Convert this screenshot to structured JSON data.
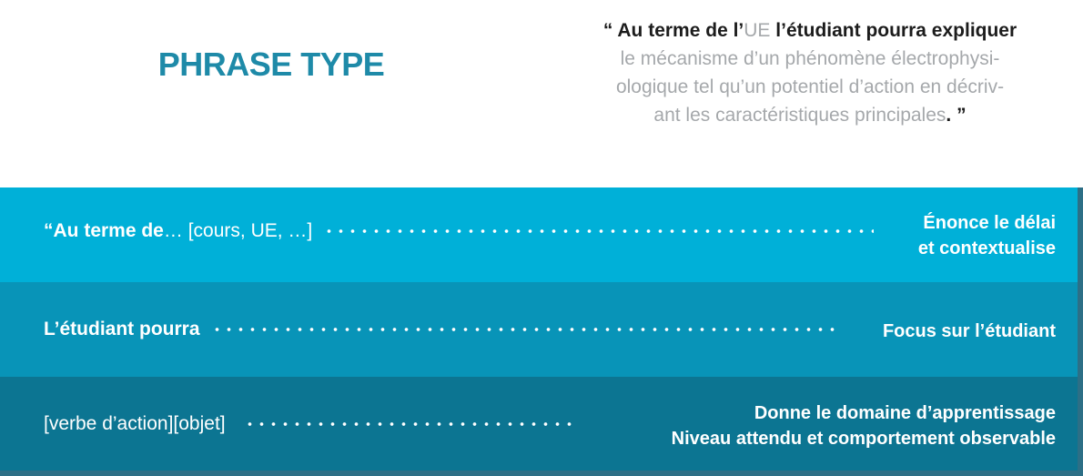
{
  "header": {
    "title": "PHRASE TYPE",
    "quote": {
      "line1_open": "“ Au terme de l’",
      "line1_ue": "UE",
      "line1_rest": " l’étudiant pourra expliquer",
      "line2": "le mécanisme d’un phénomène électrophysi-",
      "line3": "ologique tel qu’un potentiel d’action en décriv-",
      "line4": "ant les caractéristiques principales",
      "line4_end": ". ”"
    }
  },
  "rows": [
    {
      "left_bold": "“Au terme de",
      "left_rest": " … [cours, UE, …]",
      "right": [
        "Énonce le délai",
        "et contextualise"
      ]
    },
    {
      "left_bold": "L’étudiant pourra",
      "left_rest": "",
      "right": [
        "Focus sur l’étudiant"
      ]
    },
    {
      "left_bold": "",
      "left_rest": "[verbe d’action][objet]",
      "right": [
        "Donne le domaine d’apprentissage",
        "Niveau attendu et comportement observable"
      ]
    }
  ],
  "colors": {
    "title": "#1e8aa8",
    "band1": "#00b0d8",
    "band2": "#0894b8",
    "band3": "#0c7592",
    "quote_grey": "#a5a8ab"
  }
}
